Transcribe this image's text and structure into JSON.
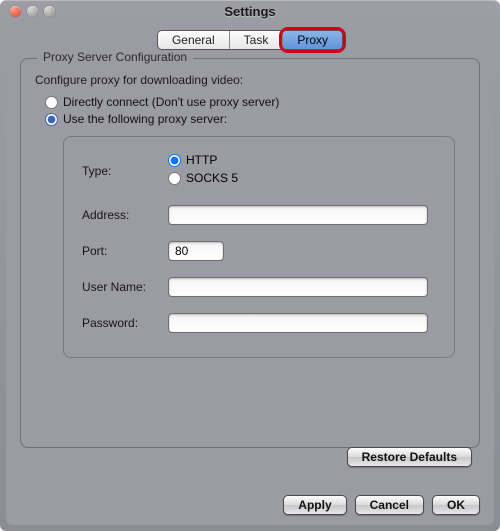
{
  "window": {
    "title": "Settings"
  },
  "tabs": {
    "general": "General",
    "task": "Task",
    "proxy": "Proxy"
  },
  "group": {
    "title": "Proxy Server Configuration",
    "desc": "Configure proxy for downloading video:",
    "opt_direct": "Directly connect (Don't use proxy server)",
    "opt_useproxy": "Use the following proxy server:"
  },
  "fields": {
    "type_label": "Type:",
    "type_http": "HTTP",
    "type_socks5": "SOCKS 5",
    "address_label": "Address:",
    "address_value": "",
    "port_label": "Port:",
    "port_value": "80",
    "username_label": "User Name:",
    "username_value": "",
    "password_label": "Password:",
    "password_value": ""
  },
  "buttons": {
    "restore": "Restore Defaults",
    "apply": "Apply",
    "cancel": "Cancel",
    "ok": "OK"
  }
}
